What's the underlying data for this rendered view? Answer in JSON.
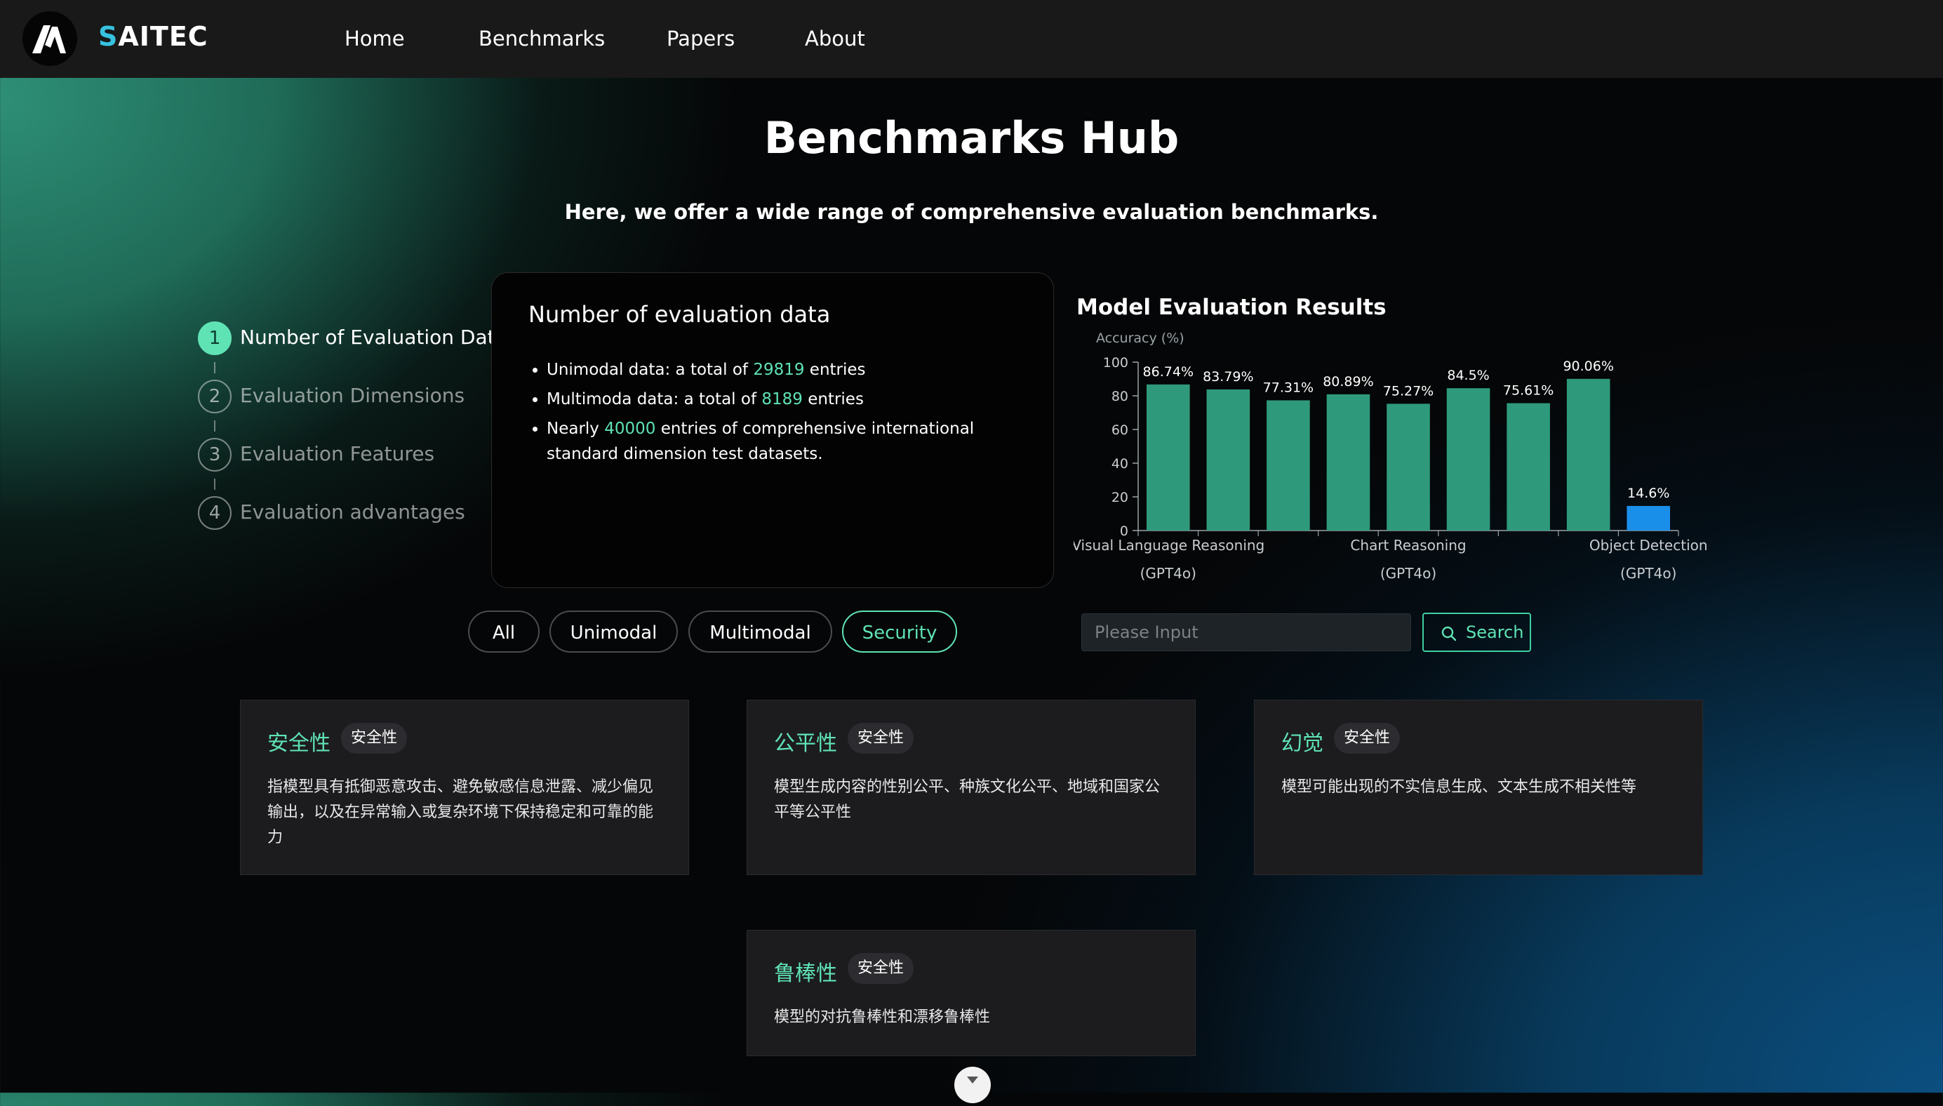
{
  "nav": {
    "brand": "AITEC",
    "brand_first": "S",
    "links": [
      "Home",
      "Benchmarks",
      "Papers",
      "About"
    ]
  },
  "hero": {
    "title": "Benchmarks Hub",
    "subtitle": "Here, we offer a wide range of comprehensive evaluation benchmarks."
  },
  "steps": [
    {
      "num": "1",
      "label": "Number of Evaluation Data",
      "active": true
    },
    {
      "num": "2",
      "label": "Evaluation Dimensions",
      "active": false
    },
    {
      "num": "3",
      "label": "Evaluation Features",
      "active": false
    },
    {
      "num": "4",
      "label": "Evaluation advantages",
      "active": false
    }
  ],
  "info": {
    "heading": "Number of evaluation data",
    "items": [
      {
        "pre": "Unimodal data: a total of ",
        "value": "29819",
        "post": " entries"
      },
      {
        "pre": "Multimoda data: a total of ",
        "value": "8189",
        "post": " entries"
      },
      {
        "pre": "Nearly ",
        "value": "40000",
        "post": " entries of comprehensive international standard dimension test datasets."
      }
    ]
  },
  "chart_data": {
    "type": "bar",
    "title": "Model Evaluation Results",
    "ylabel": "Accuracy (%)",
    "ylim": [
      0,
      100
    ],
    "yticks": [
      0,
      20,
      40,
      60,
      80,
      100
    ],
    "grid": false,
    "categories": [
      "Visual Language Reasoning (GPT4o)",
      "",
      "",
      "",
      "Chart Reasoning (GPT4o)",
      "",
      "",
      "",
      "Object Detection (GPT4o)"
    ],
    "x_tick_labels": [
      {
        "index": 0,
        "line1": "Visual Language Reasoning",
        "line2": "(GPT4o)"
      },
      {
        "index": 4,
        "line1": "Chart Reasoning",
        "line2": "(GPT4o)"
      },
      {
        "index": 8,
        "line1": "Object Detection",
        "line2": "(GPT4o)"
      }
    ],
    "values": [
      86.74,
      83.79,
      77.31,
      80.89,
      75.27,
      84.5,
      75.61,
      90.06,
      14.6
    ],
    "value_labels": [
      "86.74%",
      "83.79%",
      "77.31%",
      "80.89%",
      "75.27%",
      "84.5%",
      "75.61%",
      "90.06%",
      "14.6%"
    ],
    "colors": [
      "#2e9a7b",
      "#2e9a7b",
      "#2e9a7b",
      "#2e9a7b",
      "#2e9a7b",
      "#2e9a7b",
      "#2e9a7b",
      "#2e9a7b",
      "#1a8fea"
    ]
  },
  "filters": {
    "options": [
      "All",
      "Unimodal",
      "Multimodal",
      "Security"
    ],
    "selected": "Security"
  },
  "search": {
    "placeholder": "Please Input",
    "value": "",
    "button": "Search"
  },
  "cards": [
    {
      "title": "安全性",
      "tag": "安全性",
      "desc": "指模型具有抵御恶意攻击、避免敏感信息泄露、减少偏见输出，以及在异常输入或复杂环境下保持稳定和可靠的能力"
    },
    {
      "title": "公平性",
      "tag": "安全性",
      "desc": "模型生成内容的性别公平、种族文化公平、地域和国家公平等公平性"
    },
    {
      "title": "幻觉",
      "tag": "安全性",
      "desc": "模型可能出现的不实信息生成、文本生成不相关性等"
    },
    {
      "title": "鲁棒性",
      "tag": "安全性",
      "desc": "模型的对抗鲁棒性和漂移鲁棒性"
    }
  ],
  "colors": {
    "accent": "#5fe3b4",
    "bar": "#2e9a7b",
    "bar_highlight": "#1a8fea",
    "nav_bg": "#191919"
  }
}
